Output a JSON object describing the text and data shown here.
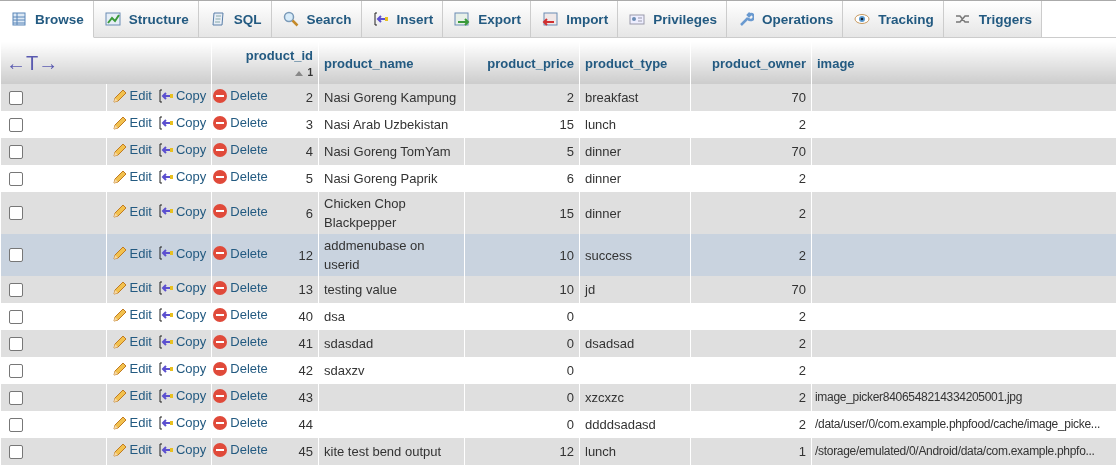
{
  "tabs": [
    {
      "label": "Browse",
      "selected": true
    },
    {
      "label": "Structure",
      "selected": false
    },
    {
      "label": "SQL",
      "selected": false
    },
    {
      "label": "Search",
      "selected": false
    },
    {
      "label": "Insert",
      "selected": false
    },
    {
      "label": "Export",
      "selected": false
    },
    {
      "label": "Import",
      "selected": false
    },
    {
      "label": "Privileges",
      "selected": false
    },
    {
      "label": "Operations",
      "selected": false
    },
    {
      "label": "Tracking",
      "selected": false
    },
    {
      "label": "Triggers",
      "selected": false
    }
  ],
  "table": {
    "column_toggle": "←T→",
    "sort_mark": "1",
    "columns": [
      {
        "label": "product_id",
        "sorted": true
      },
      {
        "label": "product_name",
        "sorted": false
      },
      {
        "label": "product_price",
        "sorted": false
      },
      {
        "label": "product_type",
        "sorted": false
      },
      {
        "label": "product_owner",
        "sorted": false
      },
      {
        "label": "image",
        "sorted": false
      }
    ],
    "rows": [
      {
        "actions": [
          "Edit",
          "Copy",
          "Delete"
        ],
        "cells": [
          "2",
          "Nasi Goreng Kampung",
          "2",
          "breakfast",
          "70",
          ""
        ],
        "checked": false,
        "selected": false
      },
      {
        "actions": [
          "Edit",
          "Copy",
          "Delete"
        ],
        "cells": [
          "3",
          "Nasi Arab Uzbekistan",
          "15",
          "lunch",
          "2",
          ""
        ],
        "checked": false,
        "selected": false
      },
      {
        "actions": [
          "Edit",
          "Copy",
          "Delete"
        ],
        "cells": [
          "4",
          "Nasi Goreng TomYam",
          "5",
          "dinner",
          "70",
          ""
        ],
        "checked": false,
        "selected": false
      },
      {
        "actions": [
          "Edit",
          "Copy",
          "Delete"
        ],
        "cells": [
          "5",
          "Nasi Goreng Paprik",
          "6",
          "dinner",
          "2",
          ""
        ],
        "checked": false,
        "selected": false
      },
      {
        "actions": [
          "Edit",
          "Copy",
          "Delete"
        ],
        "cells": [
          "6",
          "Chicken Chop Blackpepper",
          "15",
          "dinner",
          "2",
          ""
        ],
        "checked": false,
        "selected": false
      },
      {
        "actions": [
          "Edit",
          "Copy",
          "Delete"
        ],
        "cells": [
          "12",
          "addmenubase on userid",
          "10",
          "success",
          "2",
          ""
        ],
        "checked": false,
        "selected": true
      },
      {
        "actions": [
          "Edit",
          "Copy",
          "Delete"
        ],
        "cells": [
          "13",
          "testing value",
          "10",
          "jd",
          "70",
          ""
        ],
        "checked": false,
        "selected": false
      },
      {
        "actions": [
          "Edit",
          "Copy",
          "Delete"
        ],
        "cells": [
          "40",
          "dsa",
          "0",
          "",
          "2",
          ""
        ],
        "checked": false,
        "selected": false
      },
      {
        "actions": [
          "Edit",
          "Copy",
          "Delete"
        ],
        "cells": [
          "41",
          "sdasdad",
          "0",
          "dsadsad",
          "2",
          ""
        ],
        "checked": false,
        "selected": false
      },
      {
        "actions": [
          "Edit",
          "Copy",
          "Delete"
        ],
        "cells": [
          "42",
          "sdaxzv",
          "0",
          "",
          "2",
          ""
        ],
        "checked": false,
        "selected": false
      },
      {
        "actions": [
          "Edit",
          "Copy",
          "Delete"
        ],
        "cells": [
          "43",
          "",
          "0",
          "xzcxzc",
          "2",
          "image_picker8406548214334205001.jpg"
        ],
        "checked": false,
        "selected": false
      },
      {
        "actions": [
          "Edit",
          "Copy",
          "Delete"
        ],
        "cells": [
          "44",
          "",
          "0",
          "ddddsadasd",
          "2",
          "/data/user/0/com.example.phpfood/cache/image_picke..."
        ],
        "checked": false,
        "selected": false
      },
      {
        "actions": [
          "Edit",
          "Copy",
          "Delete"
        ],
        "cells": [
          "45",
          "kite test bend output",
          "12",
          "lunch",
          "1",
          "/storage/emulated/0/Android/data/com.example.phpfo..."
        ],
        "checked": false,
        "selected": false
      }
    ]
  }
}
